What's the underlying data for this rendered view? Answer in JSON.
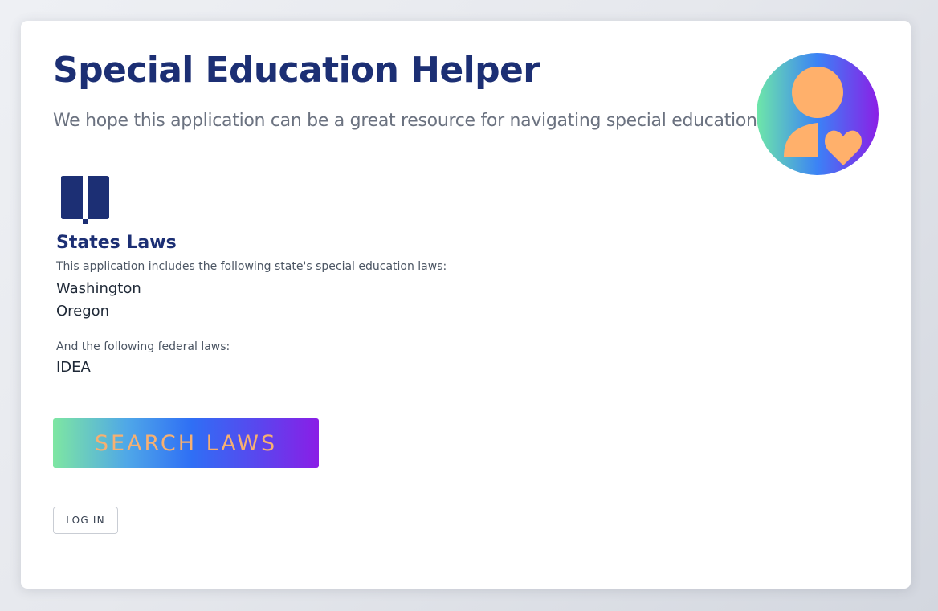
{
  "header": {
    "title": "Special Education Helper",
    "subtitle": "We hope this application can be a great resource for navigating special education."
  },
  "logo": {
    "icon": "person-heart-icon",
    "colors": {
      "gradient_start": "#6ee7a8",
      "gradient_mid": "#3b82f6",
      "gradient_end": "#8b1fe6",
      "figure": "#ffb06b"
    }
  },
  "laws": {
    "icon": "book-icon",
    "title": "States Laws",
    "intro": "This application includes the following state's special education laws:",
    "states": [
      "Washington",
      "Oregon"
    ],
    "federal_intro": "And the following federal laws:",
    "federal": [
      "IDEA"
    ]
  },
  "actions": {
    "search_label": "SEARCH LAWS",
    "login_label": "LOG IN"
  },
  "colors": {
    "primary": "#1c2f74",
    "button_text": "#f7b071"
  }
}
